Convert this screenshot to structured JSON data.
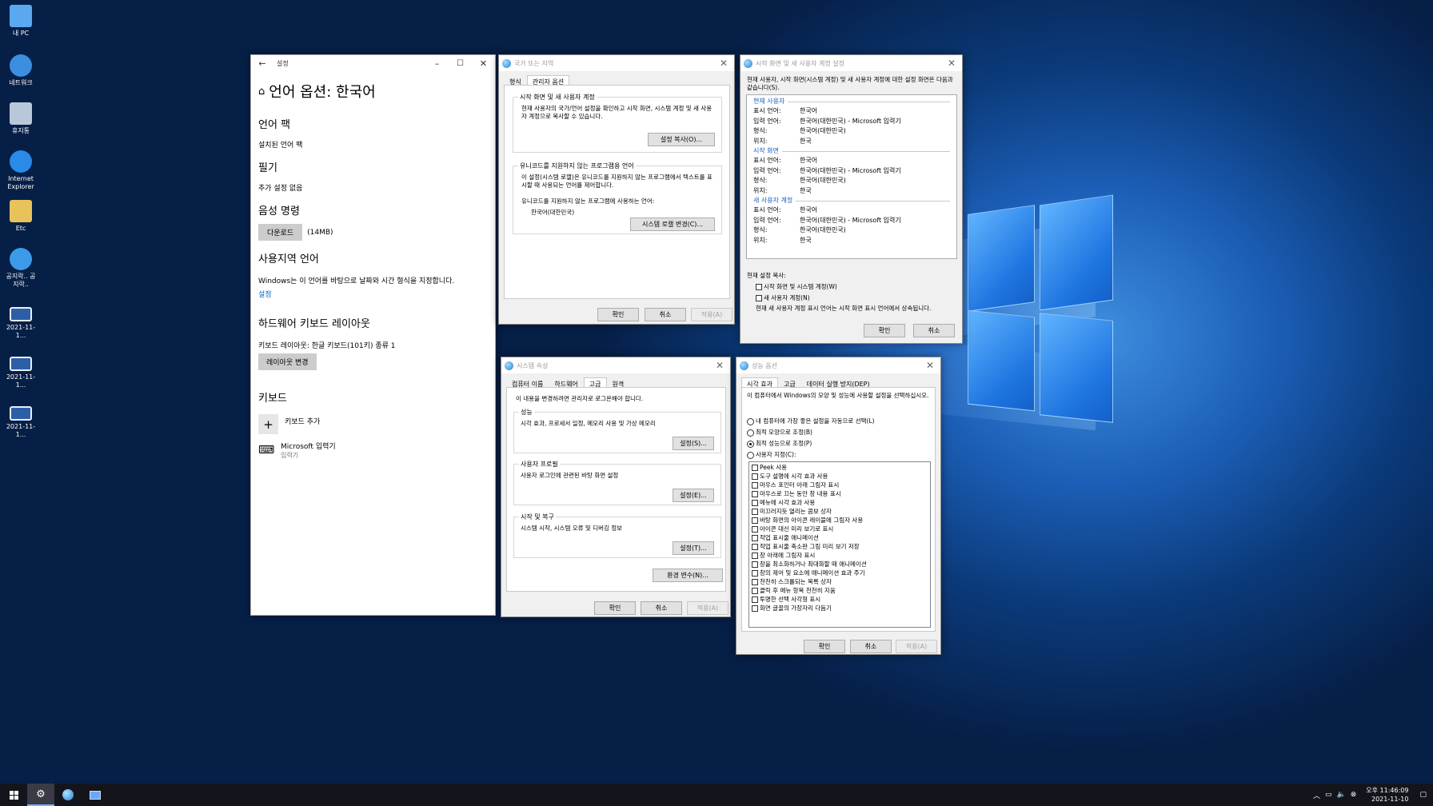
{
  "desktop": {
    "icons": [
      {
        "label": "내 PC",
        "icon": "pc-icon"
      },
      {
        "label": "네트워크",
        "icon": "network-icon"
      },
      {
        "label": "휴지통",
        "icon": "recycle-bin-icon"
      },
      {
        "label": "Internet Explorer",
        "icon": "ie-icon"
      },
      {
        "label": "Etc",
        "icon": "folder-icon"
      },
      {
        "label": "공지락.. 공지락..",
        "icon": "ie-shortcut-icon"
      },
      {
        "label": "2021-11-1...",
        "icon": "screenshot-icon"
      },
      {
        "label": "2021-11-1...",
        "icon": "screenshot-icon"
      },
      {
        "label": "2021-11-1...",
        "icon": "screenshot-icon"
      }
    ]
  },
  "settings": {
    "app_title": "설정",
    "page_title": "언어 옵션: 한국어",
    "lang_pack_h": "언어 팩",
    "lang_pack_v": "설치된 언어 팩",
    "handwriting_h": "필기",
    "handwriting_v": "추가 설정 없음",
    "voice_h": "음성 명령",
    "download_btn": "다운로드",
    "download_size": "(14MB)",
    "region_h": "사용지역 언어",
    "region_text": "Windows는 이 언어를 바탕으로 날짜와 시간 형식을 지정합니다.",
    "region_link": "설정",
    "hwkb_h": "하드웨어 키보드 레이아웃",
    "hwkb_text": "키보드 레이아웃: 한글 키보드(101키) 종류 1",
    "layout_btn": "레이아웃 변경",
    "kb_h": "키보드",
    "add_kb": "키보드 추가",
    "ime_name": "Microsoft 입력기",
    "ime_sub": "입력기"
  },
  "region": {
    "title": "국가 또는 지역",
    "tabs": [
      "형식",
      "관리자 옵션"
    ],
    "g1_title": "시작 화면 및 새 사용자 계정",
    "g1_text": "현재 사용자의 국가/언어 설정을 확인하고 시작 화면, 시스템 계정 및 새 사용자 계정으로 복사할 수 있습니다.",
    "g1_btn": "설정 복사(O)...",
    "g2_title": "유니코드를 지원하지 않는 프로그램용 언어",
    "g2_text": "이 설정(시스템 로캘)은 유니코드를 지원하지 않는 프로그램에서 텍스트를 표시할 때 사용되는 언어를 제어합니다.",
    "g2_label": "유니코드를 지원하지 않는 프로그램에 사용하는 언어:",
    "g2_value": "한국어(대한민국)",
    "g2_btn": "시스템 로캘 변경(C)...",
    "ok": "확인",
    "cancel": "취소",
    "apply": "적용(A)"
  },
  "welcome": {
    "title": "시작 화면 및 새 사용자 계정 설정",
    "intro": "현재 사용자, 시작 화면(시스템 계정) 및 새 사용자 계정에 대한 설정 화면은 다음과 같습니다(S).",
    "sections": [
      {
        "name": "현재 사용자",
        "rows": [
          {
            "k": "표시 언어:",
            "v": "한국어"
          },
          {
            "k": "입력 언어:",
            "v": "한국어(대한민국) - Microsoft 입력기"
          },
          {
            "k": "형식:",
            "v": "한국어(대한민국)"
          },
          {
            "k": "위치:",
            "v": "한국"
          }
        ]
      },
      {
        "name": "시작 화면",
        "rows": [
          {
            "k": "표시 언어:",
            "v": "한국어"
          },
          {
            "k": "입력 언어:",
            "v": "한국어(대한민국) - Microsoft 입력기"
          },
          {
            "k": "형식:",
            "v": "한국어(대한민국)"
          },
          {
            "k": "위치:",
            "v": "한국"
          }
        ]
      },
      {
        "name": "새 사용자 계정",
        "rows": [
          {
            "k": "표시 언어:",
            "v": "한국어"
          },
          {
            "k": "입력 언어:",
            "v": "한국어(대한민국) - Microsoft 입력기"
          },
          {
            "k": "형식:",
            "v": "한국어(대한민국)"
          },
          {
            "k": "위치:",
            "v": "한국"
          }
        ]
      }
    ],
    "copy_label": "현재 설정 복사:",
    "cb1": "시작 화면 및 시스템 계정(W)",
    "cb2": "새 사용자 계정(N)",
    "note": "현재 새 사용자 계정 표시 언어는 시작 화면 표시 언어에서 상속됩니다.",
    "ok": "확인",
    "cancel": "취소"
  },
  "sysprop": {
    "title": "시스템 속성",
    "tabs": [
      "컴퓨터 이름",
      "하드웨어",
      "고급",
      "원격"
    ],
    "admin_note": "이 내용을 변경하려면 관리자로 로그온해야 합니다.",
    "perf_h": "성능",
    "perf_text": "시각 효과, 프로세서 일정, 메모리 사용 및 가상 메모리",
    "perf_btn": "설정(S)...",
    "profile_h": "사용자 프로필",
    "profile_text": "사용자 로그인에 관련된 바탕 화면 설정",
    "profile_btn": "설정(E)...",
    "startup_h": "시작 및 복구",
    "startup_text": "시스템 시작, 시스템 오류 및 디버깅 정보",
    "startup_btn": "설정(T)...",
    "env_btn": "환경 변수(N)...",
    "ok": "확인",
    "cancel": "취소",
    "apply": "적용(A)"
  },
  "perf": {
    "title": "성능 옵션",
    "tabs": [
      "시각 효과",
      "고급",
      "데이터 실행 방지(DEP)"
    ],
    "desc": "이 컴퓨터에서 Windows의 모양 및 성능에 사용할 설정을 선택하십시오.",
    "radios": [
      {
        "label": "내 컴퓨터에 가장 좋은 설정을 자동으로 선택(L)",
        "on": false
      },
      {
        "label": "최적 모양으로 조정(B)",
        "on": false
      },
      {
        "label": "최적 성능으로 조정(P)",
        "on": true
      },
      {
        "label": "사용자 지정(C):",
        "on": false
      }
    ],
    "effects": [
      "Peek 사용",
      "도구 설명에 시각 효과 사용",
      "마우스 포인터 아래 그림자 표시",
      "마우스로 끄는 동안 창 내용 표시",
      "메뉴에 시각 효과 사용",
      "미끄러지듯 열리는 콤보 상자",
      "바탕 화면의 아이콘 레이블에 그림자 사용",
      "아이콘 대신 미리 보기로 표시",
      "작업 표시줄 애니메이션",
      "작업 표시줄 축소판 그림 미리 보기 저장",
      "창 아래에 그림자 표시",
      "창을 최소화하거나 최대화할 때 애니메이션",
      "창의 제어 및 요소에 애니메이션 효과 주기",
      "천천히 스크롤되는 목록 상자",
      "클릭 후 메뉴 항목 천천히 지움",
      "투명한 선택 사각형 표시",
      "화면 글꼴의 가장자리 다듬기"
    ],
    "ok": "확인",
    "cancel": "취소",
    "apply": "적용(A)"
  },
  "taskbar": {
    "time": "오후 11:46:09",
    "date": "2021-11-10"
  },
  "colors": {
    "accent": "#0078d7",
    "link": "#0067c0",
    "taskbar": "#14151c"
  }
}
